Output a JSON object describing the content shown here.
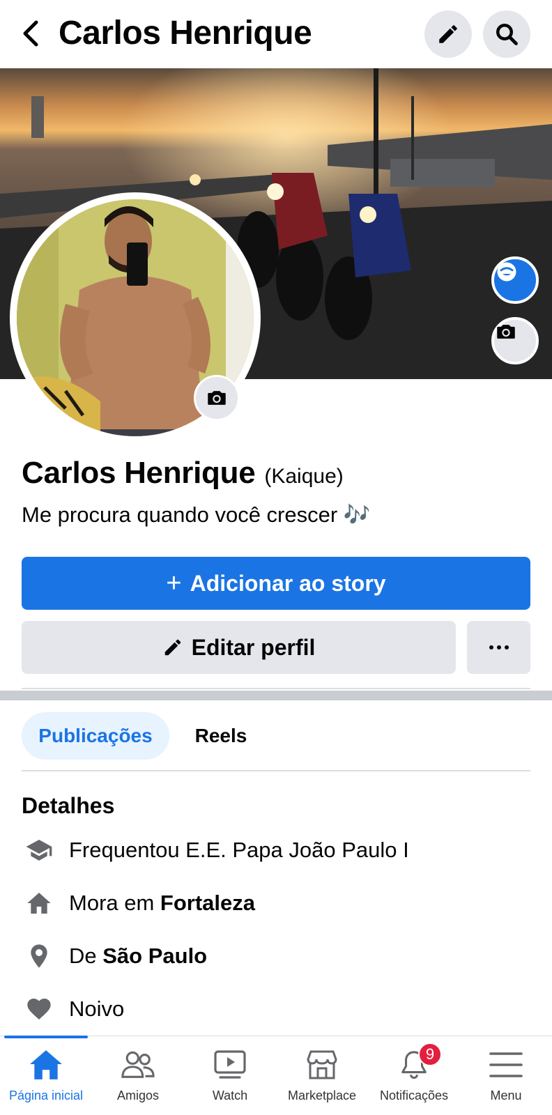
{
  "header": {
    "title": "Carlos Henrique"
  },
  "profile": {
    "name": "Carlos Henrique",
    "alternate_name": "(Kaique)",
    "bio": "Me procura quando você crescer 🎶"
  },
  "actions": {
    "add_story_label": "Adicionar ao story",
    "edit_profile_label": "Editar perfil"
  },
  "tabs": [
    {
      "label": "Publicações",
      "active": true
    },
    {
      "label": "Reels",
      "active": false
    }
  ],
  "details": {
    "title": "Detalhes",
    "items": [
      {
        "icon": "graduation-cap-icon",
        "prefix": "Frequentou E.E. Papa João Paulo I",
        "bold": ""
      },
      {
        "icon": "home-icon",
        "prefix": "Mora em ",
        "bold": "Fortaleza"
      },
      {
        "icon": "location-pin-icon",
        "prefix": "De ",
        "bold": "São Paulo"
      },
      {
        "icon": "heart-icon",
        "prefix": "Noivo",
        "bold": ""
      }
    ]
  },
  "bottom_nav": {
    "items": [
      {
        "label": "Página inicial",
        "icon": "home-icon",
        "active": true
      },
      {
        "label": "Amigos",
        "icon": "friends-icon",
        "active": false
      },
      {
        "label": "Watch",
        "icon": "watch-icon",
        "active": false
      },
      {
        "label": "Marketplace",
        "icon": "marketplace-icon",
        "active": false
      },
      {
        "label": "Notificações",
        "icon": "bell-icon",
        "active": false,
        "badge": "9"
      },
      {
        "label": "Menu",
        "icon": "menu-icon",
        "active": false
      }
    ]
  },
  "colors": {
    "accent": "#1b74e4",
    "badge": "#e41e3f",
    "button_secondary": "#e4e6eb",
    "tab_active_bg": "#e7f3ff"
  }
}
